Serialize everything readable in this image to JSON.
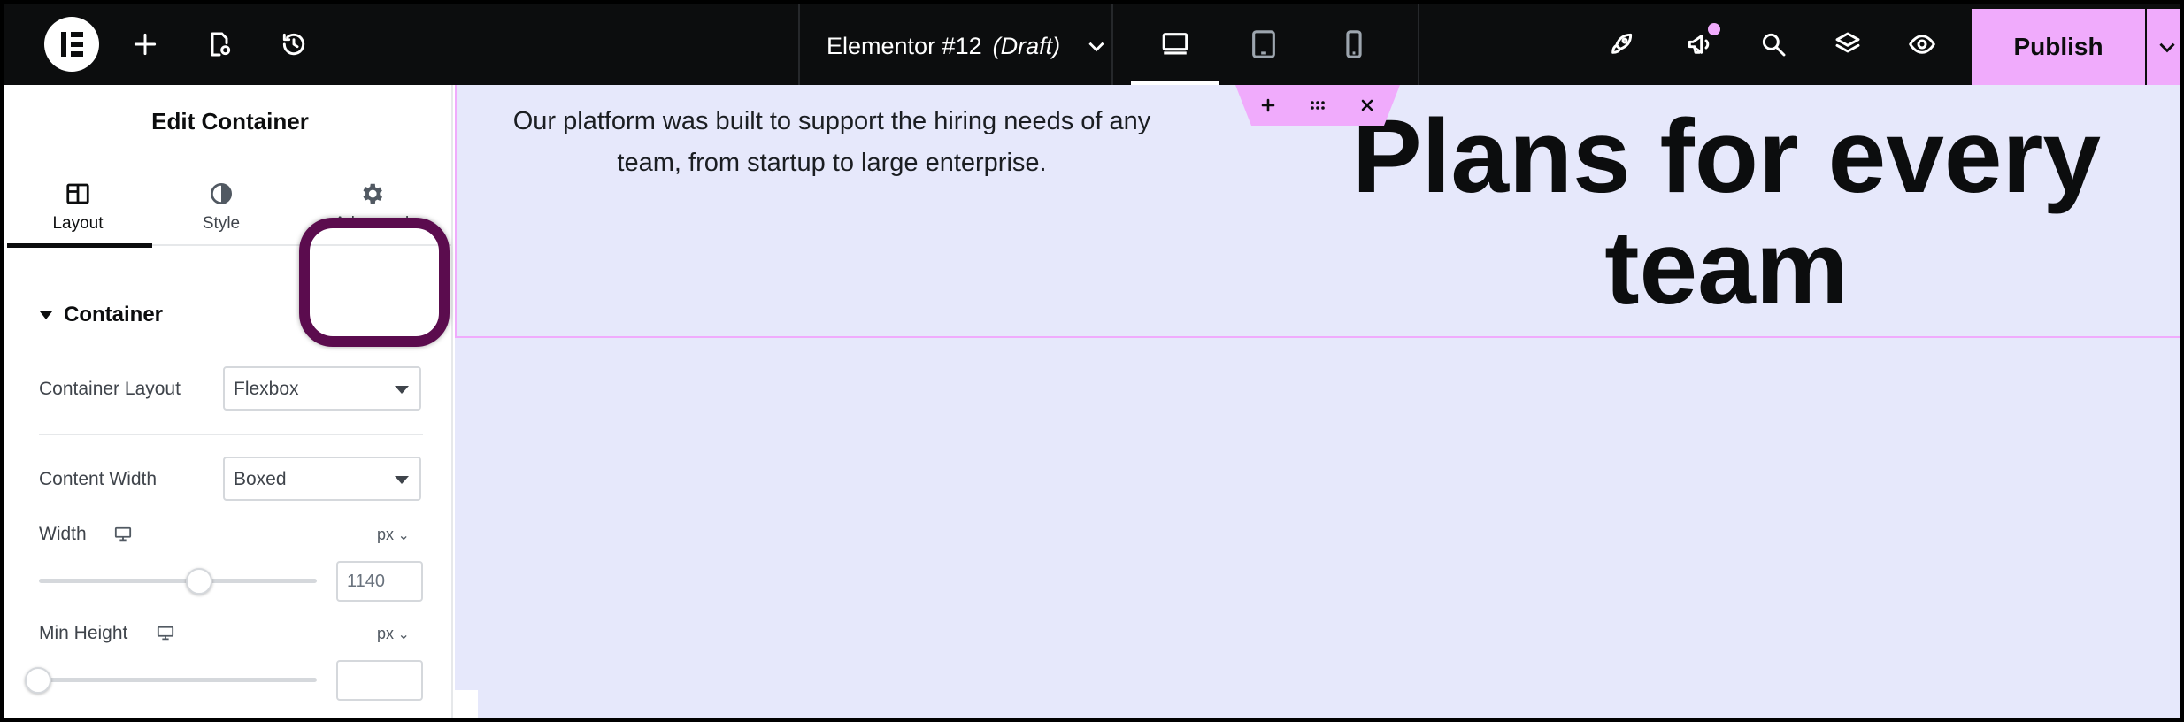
{
  "topbar": {
    "document_name": "Elementor #12",
    "document_status": "(Draft)",
    "publish_label": "Publish"
  },
  "panel": {
    "title": "Edit Container",
    "tabs": [
      {
        "label": "Layout",
        "active": true
      },
      {
        "label": "Style",
        "active": false
      },
      {
        "label": "Advanced",
        "active": false
      }
    ],
    "section_title": "Container",
    "container_layout": {
      "label": "Container Layout",
      "value": "Flexbox"
    },
    "content_width": {
      "label": "Content Width",
      "value": "Boxed"
    },
    "width": {
      "label": "Width",
      "unit": "px",
      "value": "1140"
    },
    "min_height": {
      "label": "Min Height",
      "unit": "px",
      "value": ""
    }
  },
  "canvas": {
    "paragraph": "Our platform was built to support the hiring needs of any team, from startup to large enterprise.",
    "heading": "Plans for every team"
  },
  "colors": {
    "accent": "#f0abfc",
    "highlight": "#5b0c4e",
    "canvas_bg": "#e6e8fb",
    "topbar_bg": "#0c0d0e"
  }
}
